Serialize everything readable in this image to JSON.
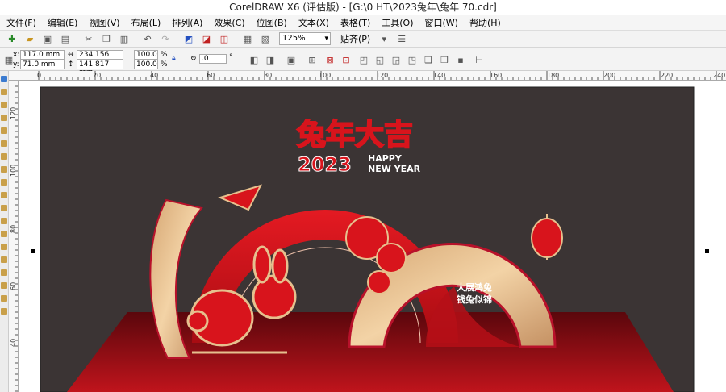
{
  "title": "CorelDRAW X6 (评估版) - [G:\\0 HT\\2023兔年\\兔年 70.cdr]",
  "menu": [
    "文件(F)",
    "编辑(E)",
    "视图(V)",
    "布局(L)",
    "排列(A)",
    "效果(C)",
    "位图(B)",
    "文本(X)",
    "表格(T)",
    "工具(O)",
    "窗口(W)",
    "帮助(H)"
  ],
  "toolbar": {
    "zoom": "125%",
    "snap": "贴齐(P)"
  },
  "props": {
    "x_label": "x:",
    "x": "117.0 mm",
    "y_label": "y:",
    "y": "71.0 mm",
    "w": "234.156 mm",
    "h": "141.817 mm",
    "sx": "100.0",
    "sy": "100.0",
    "pct": "%",
    "angle": ".0",
    "deg": "°"
  },
  "ruler_h": [
    "0",
    "20",
    "40",
    "60",
    "80",
    "100",
    "120",
    "140",
    "160",
    "180",
    "200",
    "220",
    "240"
  ],
  "ruler_v": [
    "120",
    "100",
    "80",
    "60",
    "40"
  ],
  "artwork": {
    "headline": "兔年大吉",
    "year": "2023",
    "happy": "HAPPY",
    "new_year": "NEW YEAR",
    "slogan_1": "大展鸿兔",
    "slogan_2": "钱兔似锦",
    "colors": {
      "red": "#d8141c",
      "gold": "#e6c08e",
      "background": "#3b3434",
      "floor": "#6a0b10"
    }
  }
}
